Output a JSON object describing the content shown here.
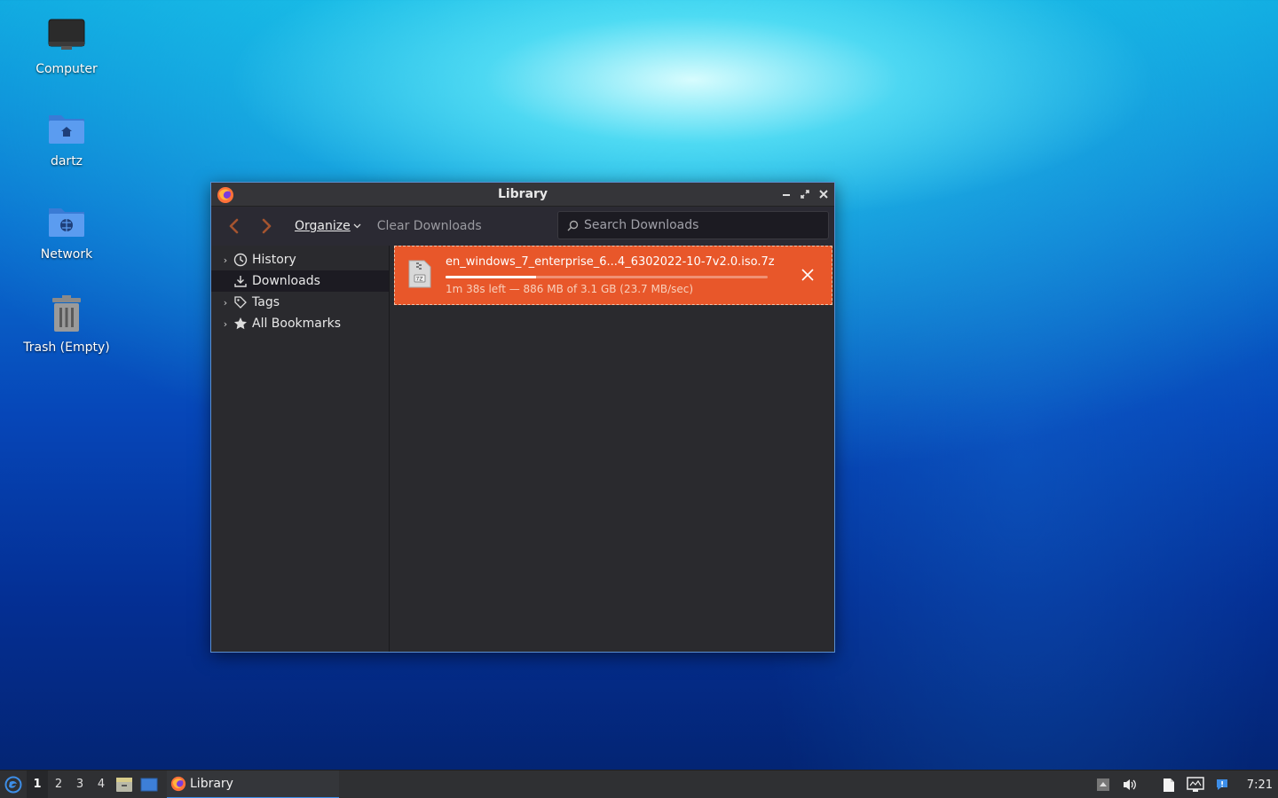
{
  "desktop": {
    "icons": [
      {
        "label": "Computer"
      },
      {
        "label": "dartz"
      },
      {
        "label": "Network"
      },
      {
        "label": "Trash (Empty)"
      }
    ]
  },
  "window": {
    "title": "Library",
    "toolbar": {
      "organize_label": "Organize",
      "clear_downloads_label": "Clear Downloads",
      "search_placeholder": "Search Downloads"
    },
    "sidebar": {
      "items": [
        {
          "label": "History",
          "icon": "clock-icon",
          "expandable": true
        },
        {
          "label": "Downloads",
          "icon": "download-icon",
          "expandable": false,
          "selected": true
        },
        {
          "label": "Tags",
          "icon": "tag-icon",
          "expandable": true
        },
        {
          "label": "All Bookmarks",
          "icon": "star-icon",
          "expandable": true
        }
      ]
    },
    "downloads": [
      {
        "filename": "en_windows_7_enterprise_6...4_6302022-10-7v2.0.iso.7z",
        "status": "1m 38s left — 886 MB of 3.1 GB (23.7 MB/sec)",
        "progress_percent": 28
      }
    ]
  },
  "taskbar": {
    "workspaces": [
      "1",
      "2",
      "3",
      "4"
    ],
    "active_workspace": "1",
    "task_label": "Library",
    "clock": "7:21"
  },
  "colors": {
    "download_highlight": "#e8572a",
    "window_border": "#5a8fd0",
    "task_underline": "#3d8ee8"
  }
}
